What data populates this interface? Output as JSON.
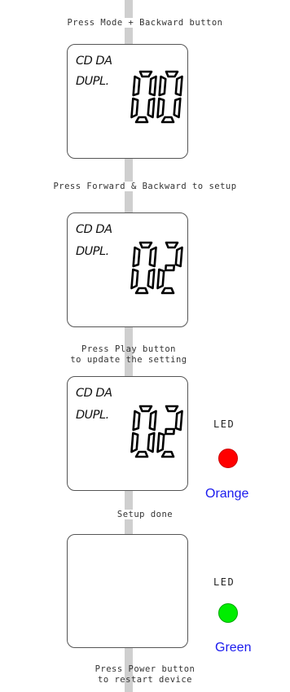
{
  "steps": [
    {
      "caption": "Press Mode + Backward button",
      "lcd": {
        "line1": "CD DA",
        "line2": "DUPL.",
        "digits": "00"
      }
    },
    {
      "caption": "Press Forward & Backward to setup",
      "lcd": {
        "line1": "CD DA",
        "line2": "DUPL.",
        "digits": "02"
      }
    },
    {
      "caption_line1": "Press Play button",
      "caption_line2": "to update the setting",
      "lcd": {
        "line1": "CD DA",
        "line2": "DUPL.",
        "digits": "02"
      },
      "led": {
        "label": "LED",
        "name": "Orange",
        "color": "#ff0000"
      }
    },
    {
      "caption": "Setup done",
      "led": {
        "label": "LED",
        "name": "Green",
        "color": "#00ee00"
      }
    },
    {
      "caption_line1": "Press Power button",
      "caption_line2": "to restart device"
    }
  ]
}
